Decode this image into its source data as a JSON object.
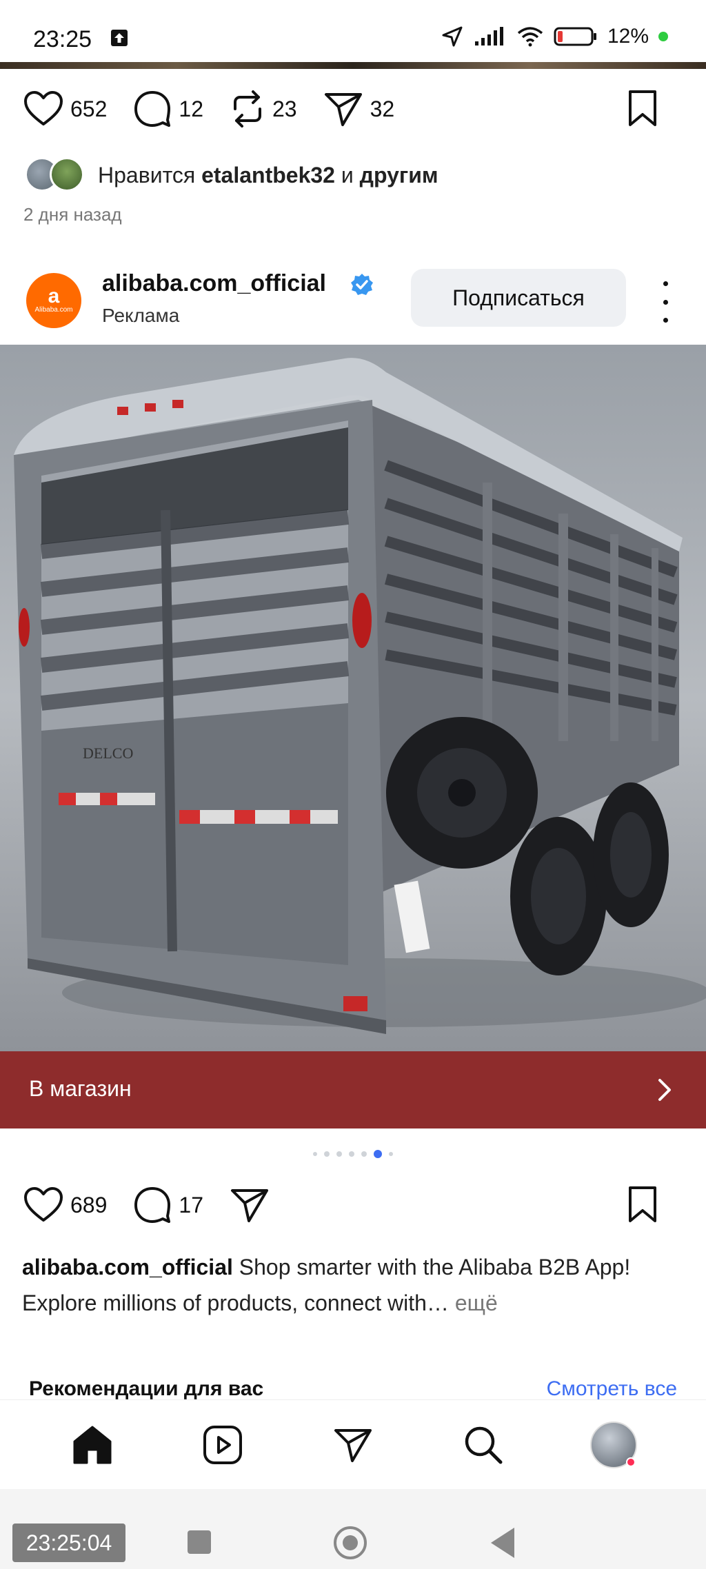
{
  "status_bar": {
    "time": "23:25",
    "battery": "12%",
    "icons": [
      "upload-icon",
      "location-icon",
      "signal-icon",
      "wifi-icon",
      "battery-icon"
    ]
  },
  "previous_post": {
    "likes": "652",
    "comments": "12",
    "reposts": "23",
    "shares": "32",
    "liked_by_prefix": "Нравится",
    "liked_by_user": "etalantbek32",
    "liked_by_middle": "и",
    "liked_by_others": "другим",
    "time_ago": "2 дня назад"
  },
  "post": {
    "account": "alibaba.com_official",
    "sponsored_label": "Реклама",
    "follow_label": "Подписаться",
    "logo_text": "a",
    "logo_subtext": "Alibaba.com",
    "image_brand_text": "DELCO",
    "cta_label": "В магазин",
    "likes": "689",
    "comments": "17",
    "caption_user": "alibaba.com_official",
    "caption_text": " Shop smarter with the Alibaba B2B App! Explore millions of products, connect with…",
    "caption_more": " ещё",
    "carousel": {
      "count": 7,
      "active_index": 5
    }
  },
  "recommendations": {
    "title": "Рекомендации для вас",
    "see_all": "Смотреть все"
  },
  "bottom_nav": {
    "items": [
      "home-icon",
      "reels-icon",
      "direct-icon",
      "search-icon",
      "profile-avatar"
    ]
  },
  "system_nav": {
    "clock": "23:25:04"
  },
  "colors": {
    "cta_bar": "#8e2c2c",
    "accent_blue": "#3d6df2",
    "alibaba_orange": "#ff6a00",
    "verified_blue": "#3897f0"
  }
}
